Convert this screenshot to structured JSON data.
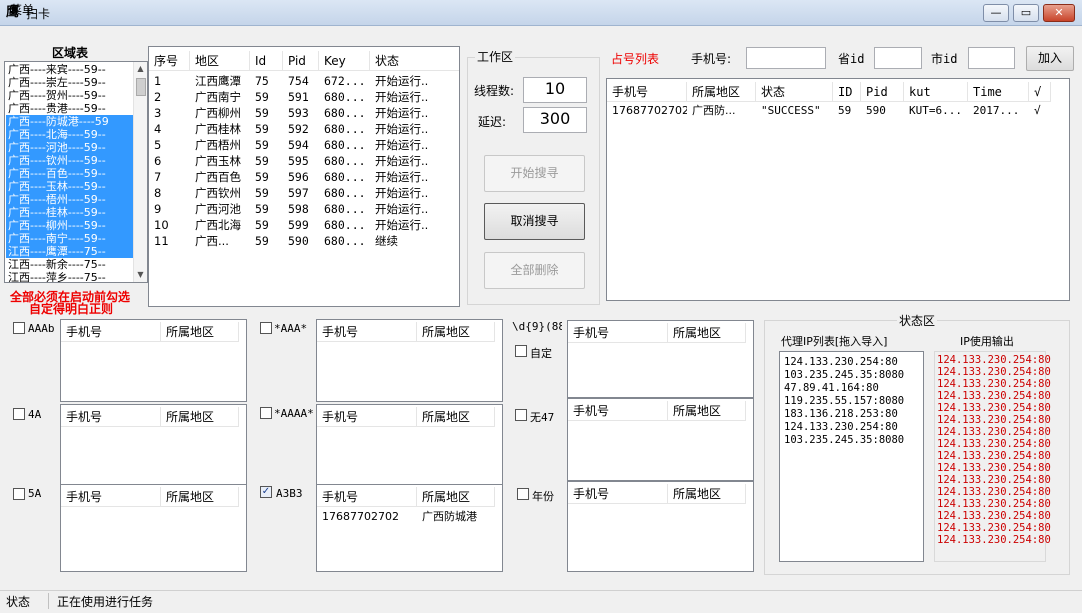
{
  "window": {
    "title": "扫卡",
    "app_icon": "鹰",
    "minimize": "—",
    "maximize": "▭",
    "close": "✕"
  },
  "menu": {
    "label": "菜单"
  },
  "region": {
    "label": "区域表",
    "items": [
      {
        "text": "广西----来宾----59--",
        "selected": false
      },
      {
        "text": "广西----崇左----59--",
        "selected": false
      },
      {
        "text": "广西----贺州----59--",
        "selected": false
      },
      {
        "text": "广西----贵港----59--",
        "selected": false
      },
      {
        "text": "广西----防城港----59",
        "selected": true
      },
      {
        "text": "广西----北海----59--",
        "selected": true
      },
      {
        "text": "广西----河池----59--",
        "selected": true
      },
      {
        "text": "广西----钦州----59--",
        "selected": true
      },
      {
        "text": "广西----百色----59--",
        "selected": true
      },
      {
        "text": "广西----玉林----59--",
        "selected": true
      },
      {
        "text": "广西----梧州----59--",
        "selected": true
      },
      {
        "text": "广西----桂林----59--",
        "selected": true
      },
      {
        "text": "广西----柳州----59--",
        "selected": true
      },
      {
        "text": "广西----南宁----59--",
        "selected": true
      },
      {
        "text": "江西----鹰潭----75--",
        "selected": true
      },
      {
        "text": "江西----新余----75--",
        "selected": false
      },
      {
        "text": "江西----萍乡----75--",
        "selected": false
      }
    ],
    "warning_1": "全部必须在启动前勾选",
    "warning_2": "自定得明白正则"
  },
  "task_table": {
    "headers": [
      "序号",
      "地区",
      "Id",
      "Pid",
      "Key",
      "状态"
    ],
    "rows": [
      [
        "1",
        "江西鹰潭",
        "75",
        "754",
        "672...",
        "开始运行.."
      ],
      [
        "2",
        "广西南宁",
        "59",
        "591",
        "680...",
        "开始运行.."
      ],
      [
        "3",
        "广西柳州",
        "59",
        "593",
        "680...",
        "开始运行.."
      ],
      [
        "4",
        "广西桂林",
        "59",
        "592",
        "680...",
        "开始运行.."
      ],
      [
        "5",
        "广西梧州",
        "59",
        "594",
        "680...",
        "开始运行.."
      ],
      [
        "6",
        "广西玉林",
        "59",
        "595",
        "680...",
        "开始运行.."
      ],
      [
        "7",
        "广西百色",
        "59",
        "596",
        "680...",
        "开始运行.."
      ],
      [
        "8",
        "广西钦州",
        "59",
        "597",
        "680...",
        "开始运行.."
      ],
      [
        "9",
        "广西河池",
        "59",
        "598",
        "680...",
        "开始运行.."
      ],
      [
        "10",
        "广西北海",
        "59",
        "599",
        "680...",
        "开始运行.."
      ],
      [
        "11",
        "广西...",
        "59",
        "590",
        "680...",
        "继续"
      ]
    ]
  },
  "work": {
    "title": "工作区",
    "threads_label": "线程数:",
    "threads_value": "10",
    "delay_label": "延迟:",
    "delay_value": "300",
    "start_label": "开始搜寻",
    "cancel_label": "取消搜寻",
    "clear_label": "全部删除"
  },
  "occupied": {
    "title": "占号列表",
    "phone_label": "手机号:",
    "province_label": "省id",
    "city_label": "市id",
    "add_label": "加入",
    "headers": [
      "手机号",
      "所属地区",
      "状态",
      "ID",
      "Pid",
      "kut",
      "Time",
      "√"
    ],
    "rows": [
      [
        "17687702702",
        "广西防...",
        "\"SUCCESS\"",
        "59",
        "590",
        "KUT=6...",
        "2017...",
        "√"
      ]
    ]
  },
  "filters": {
    "col_phone": "手机号",
    "col_region": "所属地区",
    "blocks": [
      {
        "label": "AAAb",
        "checked": false,
        "rows": []
      },
      {
        "label": "4A",
        "checked": false,
        "rows": []
      },
      {
        "label": "5A",
        "checked": false,
        "rows": []
      },
      {
        "label": "*AAA*",
        "checked": false,
        "rows": []
      },
      {
        "label": "*AAAA*",
        "checked": false,
        "rows": []
      },
      {
        "label": "A3B3",
        "checked": true,
        "rows": [
          [
            "17687702702",
            "广西防城港"
          ]
        ]
      },
      {
        "label": "自定",
        "checked": false,
        "rows": []
      },
      {
        "label": "无47",
        "checked": false,
        "rows": []
      },
      {
        "label": "年份",
        "checked": false,
        "rows": []
      }
    ],
    "regex": "\\d{9}(88"
  },
  "status_area": {
    "title": "状态区",
    "proxy_label": "代理IP列表[拖入导入]",
    "ipout_label": "IP使用输出",
    "proxies": [
      "124.133.230.254:80",
      "103.235.245.35:8080",
      "47.89.41.164:80",
      "119.235.55.157:8080",
      "183.136.218.253:80",
      "124.133.230.254:80",
      "103.235.245.35:8080"
    ],
    "ip_output": [
      "124.133.230.254:80",
      "124.133.230.254:80",
      "124.133.230.254:80",
      "124.133.230.254:80",
      "124.133.230.254:80",
      "124.133.230.254:80",
      "124.133.230.254:80",
      "124.133.230.254:80",
      "124.133.230.254:80",
      "124.133.230.254:80",
      "124.133.230.254:80",
      "124.133.230.254:80",
      "124.133.230.254:80",
      "124.133.230.254:80",
      "124.133.230.254:80",
      "124.133.230.254:80"
    ],
    "output_color": "#cc0000"
  },
  "statusbar": {
    "label": "状态",
    "text": "正在使用进行任务"
  }
}
